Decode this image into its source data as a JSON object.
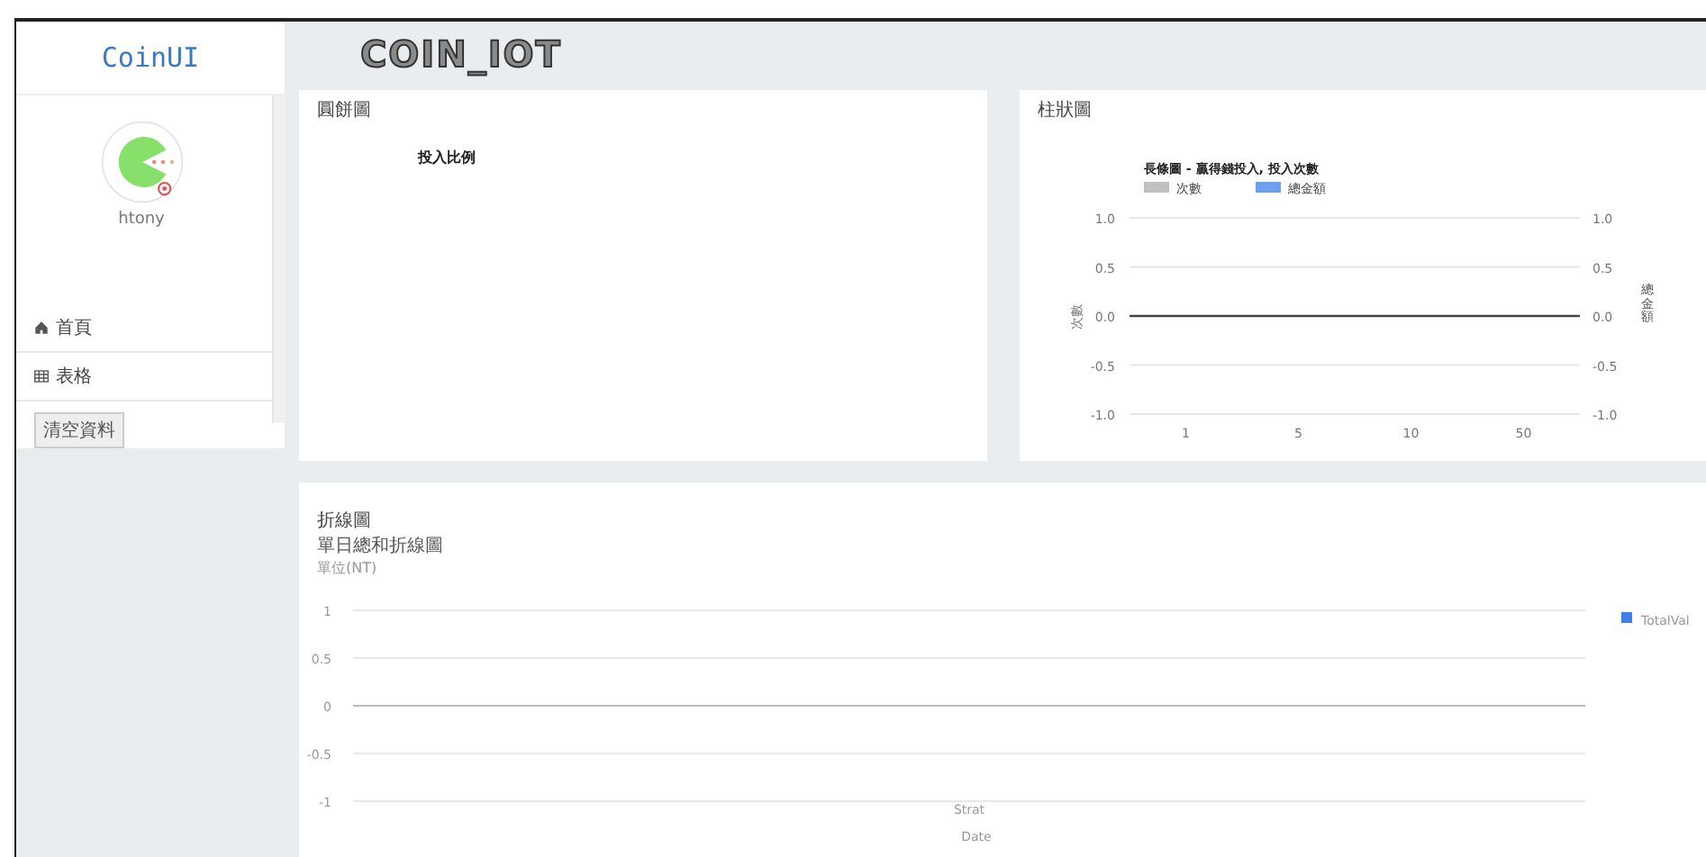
{
  "sidebar": {
    "logo": "CoinUI",
    "user": {
      "name": "htony"
    },
    "items": [
      {
        "label": "首頁",
        "selected": false
      },
      {
        "label": "表格",
        "selected": false
      }
    ],
    "clear_button": "清空資料"
  },
  "header": {
    "title": "COIN_IOT"
  },
  "pie_card": {
    "title": "圓餅圖",
    "chart_title": "投入比例"
  },
  "bar_card": {
    "title": "柱狀圖",
    "chart_data": {
      "type": "bar",
      "title": "長條圖 - 贏得錢投入, 投入次數",
      "categories": [
        "1",
        "5",
        "10",
        "50"
      ],
      "series": [
        {
          "name": "次數",
          "color": "#c0c0c0",
          "values": [
            null,
            null,
            null,
            null
          ]
        },
        {
          "name": "總金額",
          "color": "#6ea0f0",
          "values": [
            null,
            null,
            null,
            null
          ]
        }
      ],
      "ylabel": "次數",
      "y2label": "總金額",
      "ylim": [
        -1,
        1
      ],
      "yticks": [
        {
          "value": 1,
          "label": "1.0"
        },
        {
          "value": 0.5,
          "label": "0.5"
        },
        {
          "value": 0,
          "label": "0.0"
        },
        {
          "value": -0.5,
          "label": "-0.5"
        },
        {
          "value": -1,
          "label": "-1.0"
        }
      ]
    }
  },
  "line_card": {
    "title": "折線圖",
    "subtitle": "單日總和折線圖",
    "unit": "單位(NT)",
    "chart_data": {
      "type": "line",
      "xlabel": "Date",
      "ylim": [
        -1,
        1
      ],
      "categories": [
        "Strat"
      ],
      "series": [
        {
          "name": "TotalVal",
          "color": "#3f7fe8",
          "values": [
            null
          ]
        }
      ],
      "yticks": [
        {
          "value": 1,
          "label": "1"
        },
        {
          "value": 0.5,
          "label": "0.5"
        },
        {
          "value": 0,
          "label": "0"
        },
        {
          "value": -0.5,
          "label": "-0.5"
        },
        {
          "value": -1,
          "label": "-1"
        }
      ]
    }
  }
}
